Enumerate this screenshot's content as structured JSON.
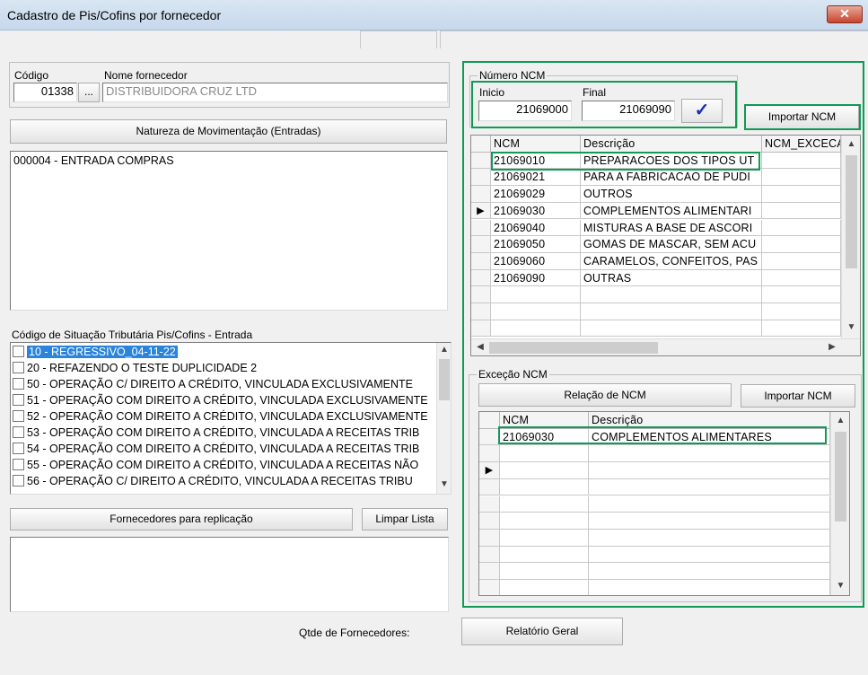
{
  "window": {
    "title": "Cadastro de Pis/Cofins por fornecedor",
    "close_glyph": "✕"
  },
  "supplier": {
    "codigo_label": "Código",
    "codigo_value": "01338",
    "lookup_label": "...",
    "nome_label": "Nome fornecedor",
    "nome_value": "DISTRIBUIDORA CRUZ LTD"
  },
  "natureza": {
    "button_label": "Natureza de Movimentação (Entradas)",
    "items": [
      "000004 - ENTRADA COMPRAS"
    ]
  },
  "cst": {
    "label": "Código de Situação Tributária Pis/Cofins - Entrada",
    "items": [
      "10 - REGRESSIVO_04-11-22",
      "20 - REFAZENDO O TESTE DUPLICIDADE 2",
      "50 - OPERAÇÃO C/ DIREITO A CRÉDITO, VINCULADA EXCLUSIVAMENTE",
      "51 - OPERAÇÃO COM DIREITO A CRÉDITO, VINCULADA EXCLUSIVAMENTE",
      "52 - OPERAÇÃO COM DIREITO A CRÉDITO, VINCULADA EXCLUSIVAMENTE",
      "53 - OPERAÇÃO COM DIREITO A CRÉDITO, VINCULADA A RECEITAS TRIB",
      "54 - OPERAÇÃO COM DIREITO A CRÉDITO, VINCULADA A RECEITAS TRIB",
      "55 - OPERAÇÃO COM DIREITO A CRÉDITO, VINCULADA A RECEITAS NÃO",
      "56 - OPERAÇÃO C/ DIREITO A CRÉDITO, VINCULADA A RECEITAS TRIBU"
    ]
  },
  "replicacao": {
    "button_label": "Fornecedores para replicação",
    "limpar_label": "Limpar Lista",
    "qtde_label": "Qtde de Fornecedores:"
  },
  "numero_ncm": {
    "group_label": "Número NCM",
    "inicio_label": "Inicio",
    "inicio_value": "21069000",
    "final_label": "Final",
    "final_value": "21069090",
    "confirm_glyph": "✓",
    "importar_label": "Importar NCM",
    "columns": [
      "NCM",
      "Descrição",
      "NCM_EXCECAO"
    ],
    "rows": [
      {
        "ncm": "21069010",
        "descricao": "PREPARACOES DOS TIPOS UT"
      },
      {
        "ncm": "21069021",
        "descricao": "PARA A FABRICACAO DE PUDI"
      },
      {
        "ncm": "21069029",
        "descricao": "OUTROS"
      },
      {
        "ncm": "21069030",
        "descricao": "COMPLEMENTOS ALIMENTARI"
      },
      {
        "ncm": "21069040",
        "descricao": "MISTURAS A BASE DE ASCORI"
      },
      {
        "ncm": "21069050",
        "descricao": "GOMAS DE MASCAR, SEM ACU"
      },
      {
        "ncm": "21069060",
        "descricao": "CARAMELOS, CONFEITOS, PAS"
      },
      {
        "ncm": "21069090",
        "descricao": "OUTRAS"
      }
    ]
  },
  "excecao_ncm": {
    "group_label": "Exceção NCM",
    "relacao_label": "Relação de NCM",
    "importar_label": "Importar NCM",
    "columns": [
      "NCM",
      "Descrição"
    ],
    "rows": [
      {
        "ncm": "21069030",
        "descricao": "COMPLEMENTOS ALIMENTARES"
      }
    ]
  },
  "relatorio": {
    "button_label": "Relatório Geral"
  },
  "colors": {
    "highlight": "#0f9a55",
    "selection": "#2a84dc"
  }
}
